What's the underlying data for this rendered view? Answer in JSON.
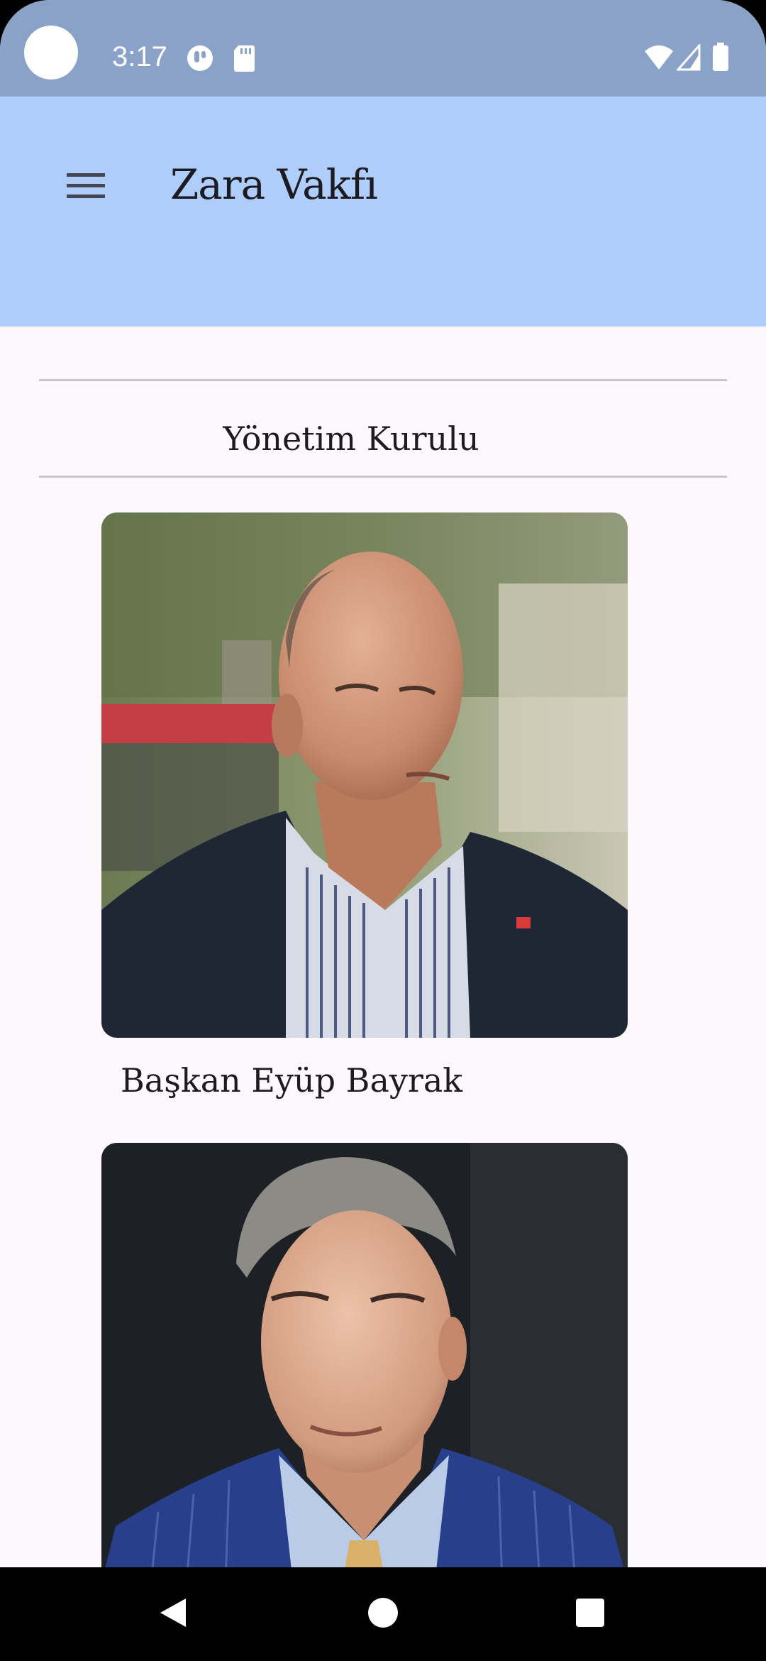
{
  "status_bar": {
    "time": "3:17",
    "icons": [
      "notification-app-icon",
      "sd-card-icon",
      "wifi-icon",
      "signal-icon",
      "battery-icon"
    ]
  },
  "app_bar": {
    "title": "Zara Vakfı",
    "menu_icon": "hamburger-menu-icon",
    "background": "#aecdfb"
  },
  "section": {
    "title": "Yönetim Kurulu"
  },
  "members": [
    {
      "name": "Başkan Eyüp Bayrak"
    },
    {
      "name": ""
    }
  ],
  "nav_bar": {
    "buttons": [
      "back-icon",
      "home-icon",
      "recents-icon"
    ]
  },
  "colors": {
    "status_bar": "#8aa2c8",
    "app_bar": "#aecdfb",
    "surface": "#fdf8fc",
    "text": "#1b1b21"
  }
}
